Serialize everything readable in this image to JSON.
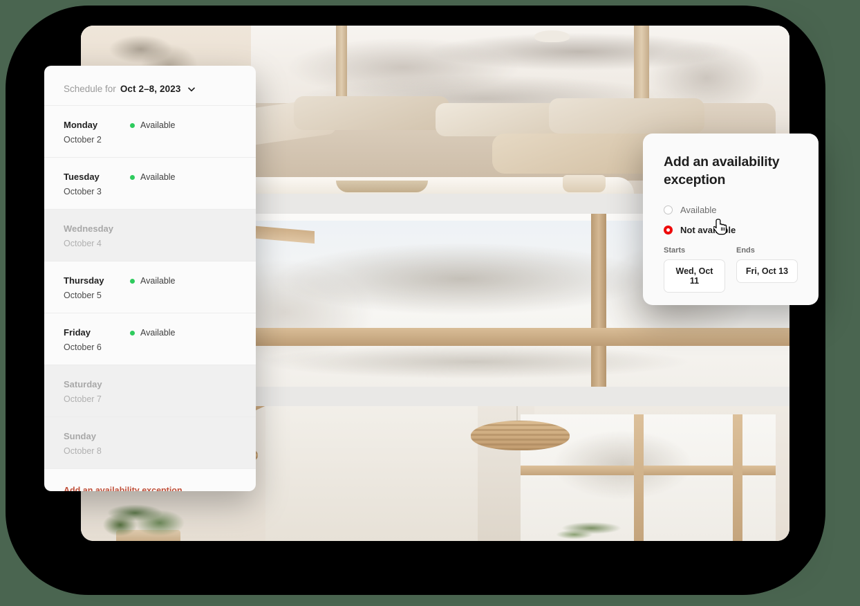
{
  "background": {
    "canvas_color": "#4a6550",
    "blob_color": "#000000"
  },
  "photo_panel": {
    "images": [
      {
        "alt": "cozy living room with beige sofa and snowy window view"
      },
      {
        "alt": "large wooden framed window overlooking snow covered trees"
      },
      {
        "alt": "interior with rattan pendant lamps, wooden ceiling and plants"
      }
    ]
  },
  "schedule": {
    "header": {
      "prefix": "Schedule for",
      "range": "Oct 2–8, 2023",
      "chevron_icon": "chevron-down-icon"
    },
    "status_colors": {
      "available": "#2ecb5d"
    },
    "days": [
      {
        "name": "Monday",
        "date": "October 2",
        "status": "Available",
        "unavailable": false
      },
      {
        "name": "Tuesday",
        "date": "October 3",
        "status": "Available",
        "unavailable": false
      },
      {
        "name": "Wednesday",
        "date": "October 4",
        "status": "",
        "unavailable": true
      },
      {
        "name": "Thursday",
        "date": "October 5",
        "status": "Available",
        "unavailable": false
      },
      {
        "name": "Friday",
        "date": "October 6",
        "status": "Available",
        "unavailable": false
      },
      {
        "name": "Saturday",
        "date": "October 7",
        "status": "",
        "unavailable": true
      },
      {
        "name": "Sunday",
        "date": "October 8",
        "status": "",
        "unavailable": true
      }
    ],
    "footer_link": "Add an availability exception",
    "link_color": "#c0503a"
  },
  "dialog": {
    "title": "Add an availability exception",
    "options": [
      {
        "label": "Available",
        "selected": false
      },
      {
        "label": "Not available",
        "selected": true
      }
    ],
    "selected_color": "#ee0b0b",
    "fields": [
      {
        "label": "Starts",
        "value": "Wed, Oct 11"
      },
      {
        "label": "Ends",
        "value": "Fri, Oct 13"
      }
    ]
  },
  "cursor": {
    "icon": "pointer-hand-cursor"
  }
}
